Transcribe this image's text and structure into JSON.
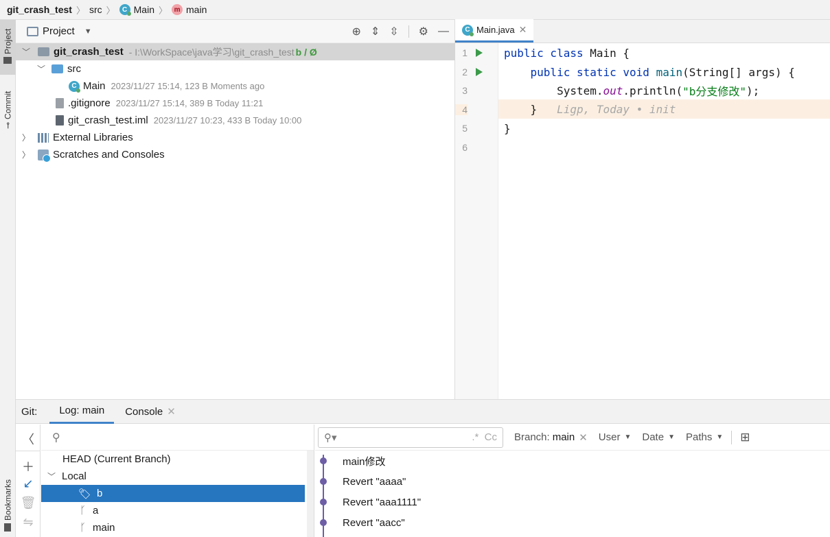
{
  "breadcrumb": {
    "project": "git_crash_test",
    "folder": "src",
    "class_icon": "C",
    "class_name": "Main",
    "method_icon": "m",
    "method_name": "main"
  },
  "left_strip": {
    "project": "Project",
    "commit": "Commit",
    "bookmarks": "Bookmarks"
  },
  "project_panel": {
    "title": "Project",
    "tree": {
      "root_name": "git_crash_test",
      "root_path": " - I:\\WorkSpace\\java学习\\git_crash_test",
      "root_branch": "b / Ø",
      "src": "src",
      "main_name": "Main",
      "main_meta": "2023/11/27 15:14, 123 B Moments ago",
      "gitignore_name": ".gitignore",
      "gitignore_meta": "2023/11/27 15:14, 389 B Today 11:21",
      "iml_name": "git_crash_test.iml",
      "iml_meta": "2023/11/27 10:23, 433 B Today 10:00",
      "ext_libs": "External Libraries",
      "scratches": "Scratches and Consoles"
    }
  },
  "editor": {
    "tab_label": "Main.java",
    "line_numbers": [
      "1",
      "2",
      "3",
      "4",
      "5",
      "6"
    ],
    "code": {
      "l1_kw": "public class ",
      "l1_rest": "Main {",
      "l2_kw": "    public static void ",
      "l2_fn": "main",
      "l2_rest": "(String[] args) {",
      "l3_pre": "        System.",
      "l3_out": "out",
      "l3_mid": ".println(",
      "l3_str": "\"b分支修改\"",
      "l3_end": ");",
      "l4_code": "    }",
      "l4_hint": "   Ligp, Today • init",
      "l5_code": "}"
    }
  },
  "bottom": {
    "git_label": "Git:",
    "log_tab": "Log: main",
    "console_tab": "Console",
    "branches": {
      "head": "HEAD (Current Branch)",
      "local": "Local",
      "b": "b",
      "a": "a",
      "main": "main"
    },
    "log": {
      "branch_label": "Branch:",
      "branch_value": "main",
      "user": "User",
      "date": "Date",
      "paths": "Paths",
      "commits": [
        "main修改",
        "Revert \"aaaa\"",
        "Revert \"aaa1111\"",
        "Revert \"aacc\""
      ]
    }
  },
  "colors": {
    "accent": "#4083c9",
    "selection": "#2675bf",
    "graph": "#6d5ea6",
    "keyword": "#0033b3",
    "string": "#067d17",
    "highlight_line": "#fcefe1"
  }
}
